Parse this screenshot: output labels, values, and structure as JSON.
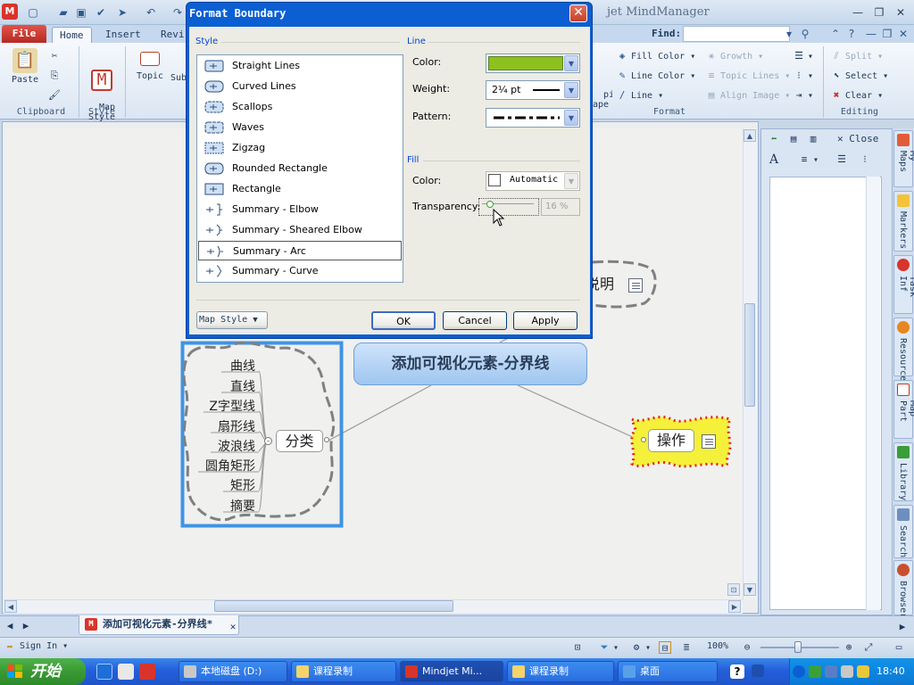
{
  "title_bar": {
    "app_title": "jet MindManager",
    "app_logo": "M"
  },
  "ribbon": {
    "file_tab": "File",
    "tabs": [
      "Home",
      "Insert",
      "Revi"
    ],
    "find_label": "Find:",
    "groups": {
      "clipboard": {
        "label": "Clipboard",
        "paste": "Paste"
      },
      "style": {
        "label": "Style",
        "map_style": "Map\nStyle"
      },
      "topic": {
        "topic": "Topic",
        "sub": "Sub"
      },
      "format": {
        "label": "Format",
        "topic_shape_partial": "pic\nape",
        "fill_color": "Fill Color",
        "line_color": "Line Color",
        "line": "Line",
        "growth": "Growth",
        "topic_lines": "Topic Lines",
        "align_image": "Align Image"
      },
      "editing": {
        "label": "Editing",
        "split": "Split",
        "select": "Select",
        "clear": "Clear"
      }
    }
  },
  "dialog": {
    "title": "Format Boundary",
    "style_group": "Style",
    "line_group": "Line",
    "fill_group": "Fill",
    "styles": [
      "Straight Lines",
      "Curved Lines",
      "Scallops",
      "Waves",
      "Zigzag",
      "Rounded Rectangle",
      "Rectangle",
      "Summary - Elbow",
      "Summary - Sheared Elbow",
      "Summary - Arc",
      "Summary - Curve"
    ],
    "selected_style": "Summary - Arc",
    "line": {
      "color_label": "Color:",
      "color_value": "#8dc11f",
      "weight_label": "Weight:",
      "weight_value": "2¼ pt",
      "pattern_label": "Pattern:"
    },
    "fill": {
      "color_label": "Color:",
      "color_value": "Automatic",
      "transparency_label": "Transparency:",
      "transparency_value": "16 %",
      "transparency_level": 0.16
    },
    "map_style_button": "Map Style",
    "ok": "OK",
    "cancel": "Cancel",
    "apply": "Apply"
  },
  "map": {
    "central_topic": "添加可视化元素-分界线",
    "fenlei": "分类",
    "subtopics": [
      "曲线",
      "直线",
      "Z字型线",
      "扇形线",
      "波浪线",
      "圆角矩形",
      "矩形",
      "摘要"
    ],
    "caozuo": "操作",
    "shuoming_partial": "说明"
  },
  "task_pane": {
    "close": "Close",
    "side_tabs": [
      "My Maps",
      "Markers",
      "Task Inf",
      "Resource",
      "Map Part",
      "Library",
      "Search",
      "Browser"
    ]
  },
  "doc_tab": {
    "title": "添加可视化元素-分界线*"
  },
  "status_bar": {
    "sign_in": "Sign In",
    "zoom": "100%"
  },
  "taskbar": {
    "start": "开始",
    "buttons": [
      "本地磁盘 (D:)",
      "课程录制",
      "Mindjet Mi...",
      "课程录制",
      "桌面"
    ],
    "clock": "18:40"
  },
  "colors": {
    "boundary_selected": "#3f94e4",
    "line_green": "#8dc11f",
    "caozuo_fill": "#f5f03a",
    "caozuo_border": "#e0261d"
  }
}
